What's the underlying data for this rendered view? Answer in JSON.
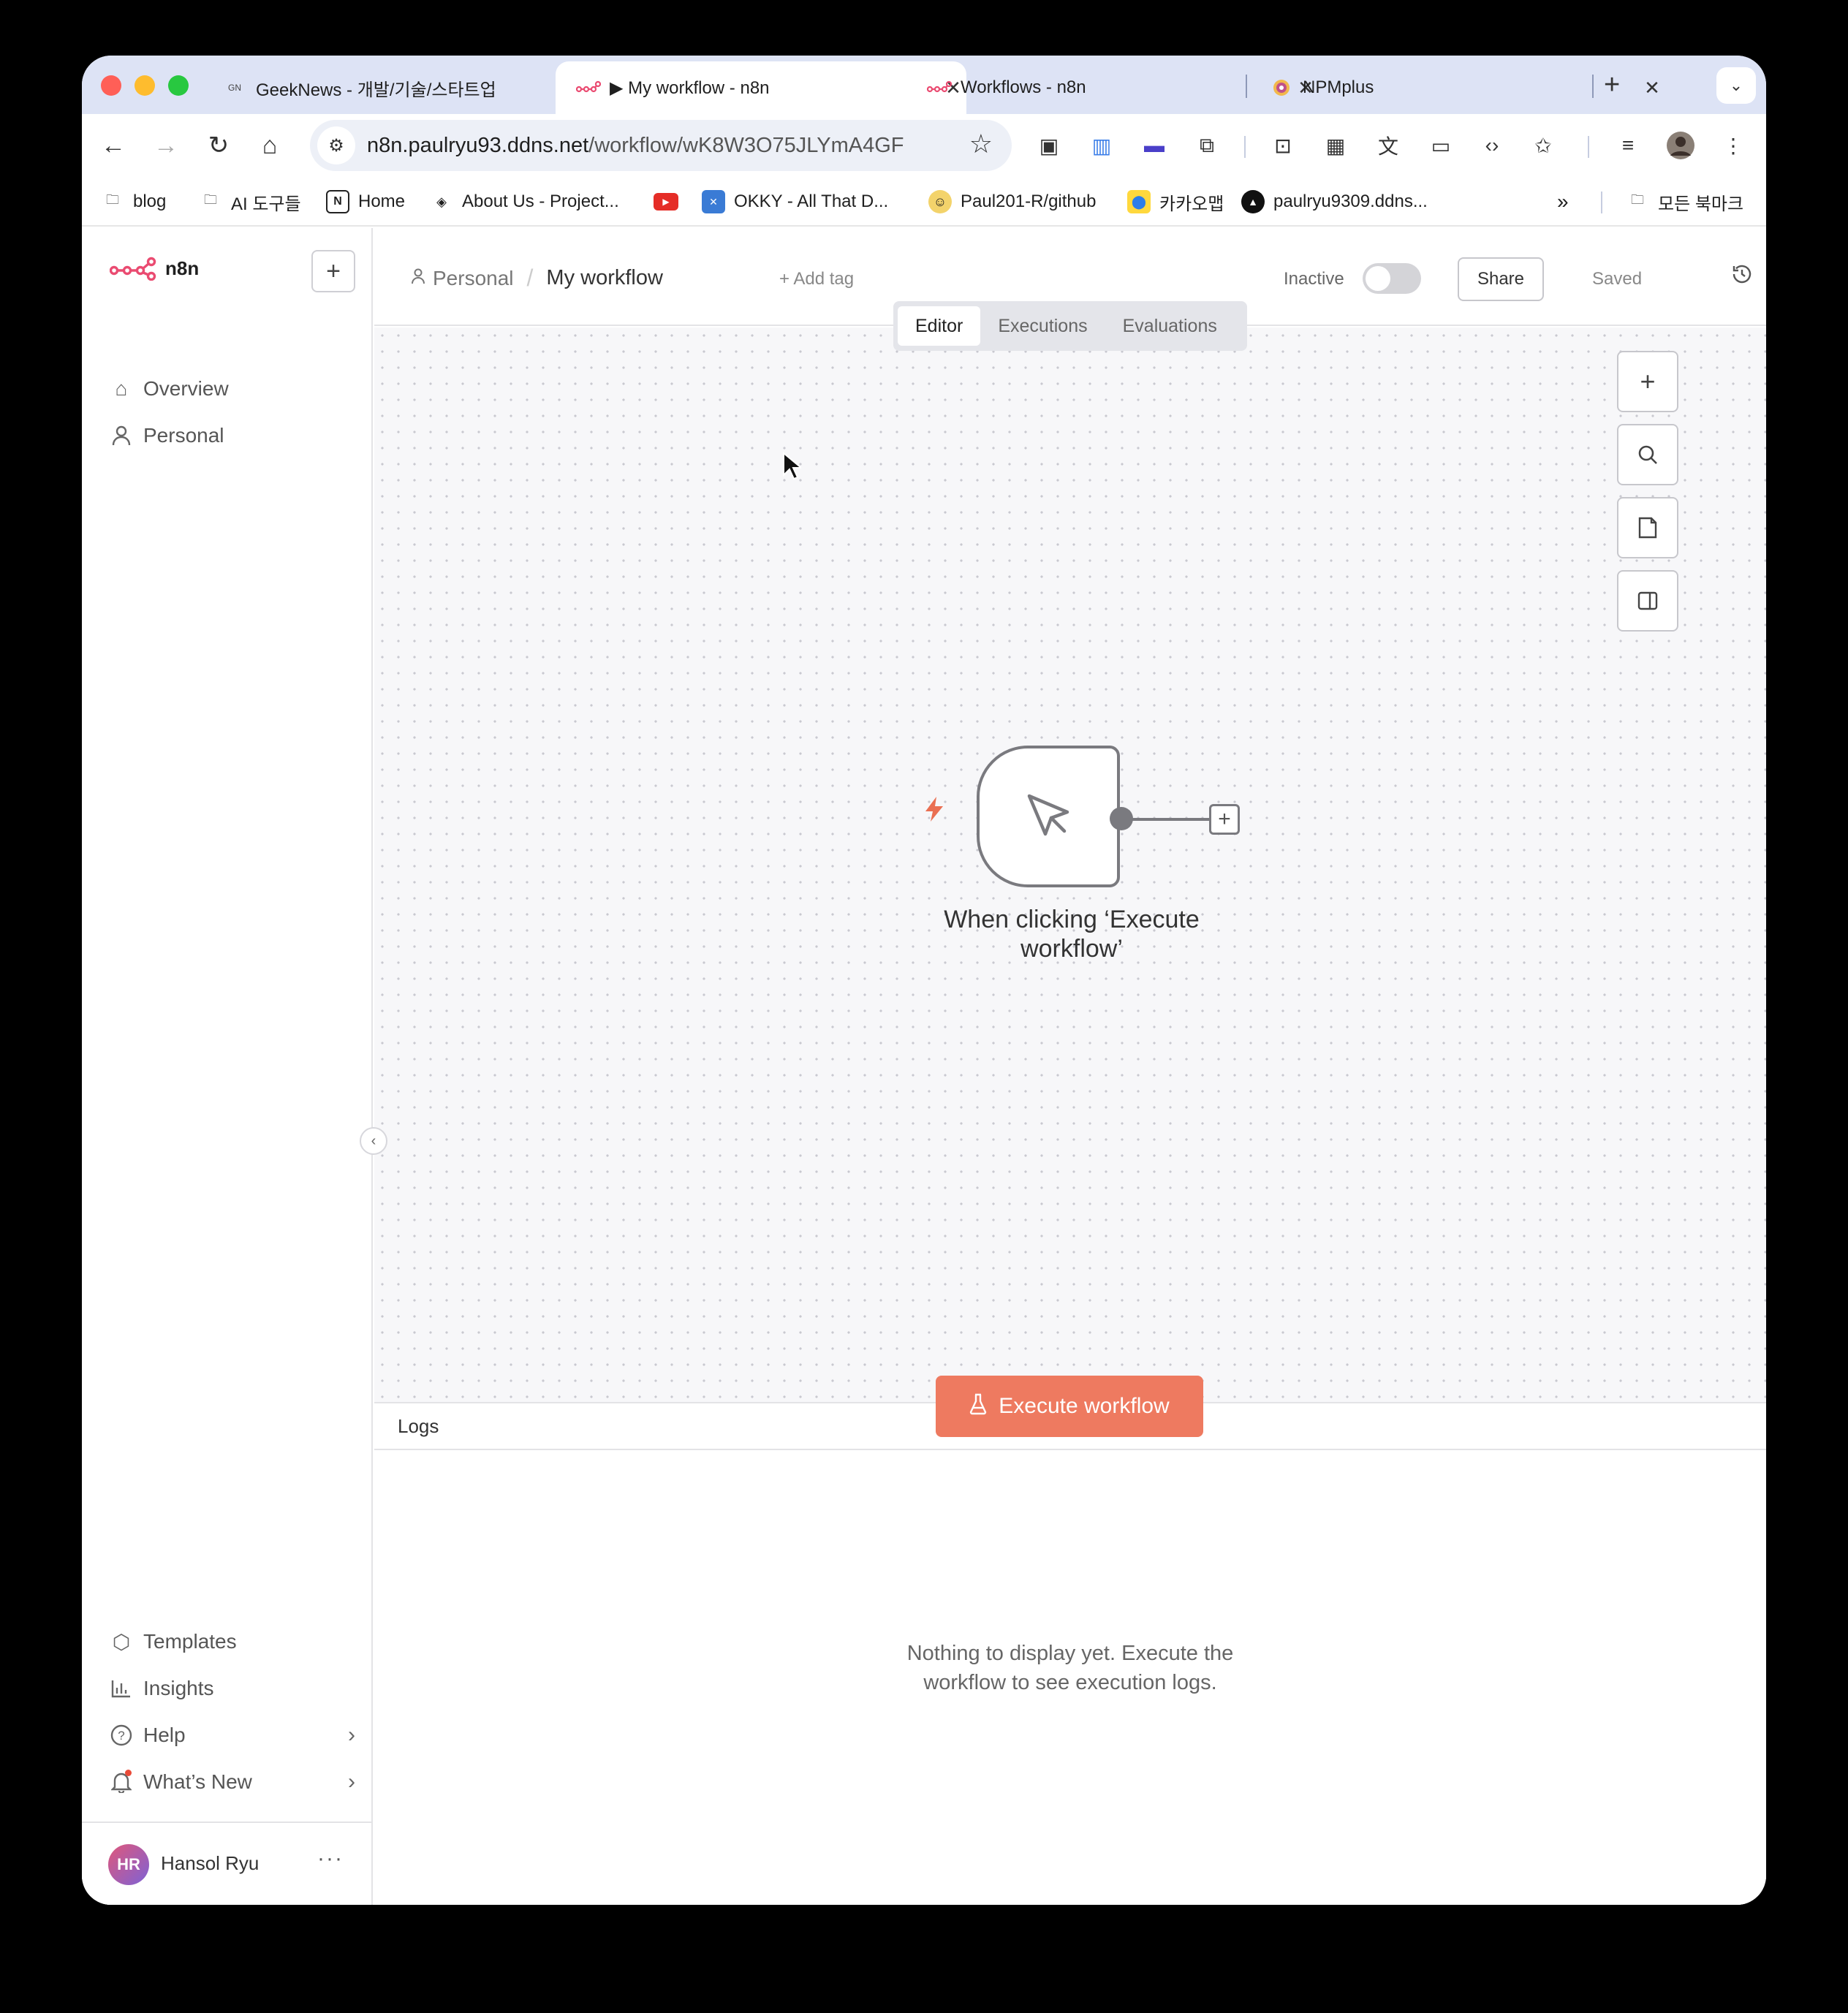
{
  "browser": {
    "tabs": [
      {
        "title": "GeekNews - 개발/기술/스타트업",
        "favicon": "GN",
        "active": false
      },
      {
        "title": "▶ My workflow - n8n",
        "favicon": "n8n",
        "active": true
      },
      {
        "title": "Workflows - n8n",
        "favicon": "n8n",
        "active": false
      },
      {
        "title": "NPMplus",
        "favicon": "npm",
        "active": false
      }
    ],
    "url_host": "n8n.paulryu93.ddns.net",
    "url_path": "/workflow/wK8W3O75JLYmA4GF",
    "bookmarks": [
      {
        "label": "blog",
        "icon": "folder-icon"
      },
      {
        "label": "AI 도구들",
        "icon": "folder-icon"
      },
      {
        "label": "Home",
        "icon": "notion-icon"
      },
      {
        "label": "About Us - Project...",
        "icon": "stack-icon"
      },
      {
        "label": "",
        "icon": "youtube-icon"
      },
      {
        "label": "OKKY - All That D...",
        "icon": "okky-icon"
      },
      {
        "label": "Paul201-R/github",
        "icon": "emoji-icon"
      },
      {
        "label": "카카오맵",
        "icon": "map-pin-icon"
      },
      {
        "label": "paulryu9309.ddns...",
        "icon": "triangle-icon"
      }
    ],
    "all_bookmarks": "모든 북마크"
  },
  "sidebar": {
    "logo": "n8n",
    "top_items": [
      {
        "label": "Overview",
        "icon": "home-icon"
      },
      {
        "label": "Personal",
        "icon": "user-icon"
      }
    ],
    "bottom_items": [
      {
        "label": "Templates",
        "icon": "box-icon"
      },
      {
        "label": "Insights",
        "icon": "chart-icon"
      },
      {
        "label": "Help",
        "icon": "help-icon"
      },
      {
        "label": "What’s New",
        "icon": "bell-icon"
      }
    ],
    "user": {
      "initials": "HR",
      "name": "Hansol Ryu"
    }
  },
  "header": {
    "project": "Personal",
    "workflow_name": "My workflow",
    "add_tag": "+ Add tag",
    "status": "Inactive",
    "share": "Share",
    "saved": "Saved"
  },
  "view_tabs": [
    "Editor",
    "Executions",
    "Evaluations"
  ],
  "canvas": {
    "node_label": "When clicking ‘Execute workflow’",
    "execute_button": "Execute workflow"
  },
  "logs": {
    "title": "Logs",
    "empty_message": "Nothing to display yet. Execute the workflow to see execution logs."
  },
  "colors": {
    "accent": "#ee7a60",
    "trigger": "#ea6f52",
    "brand": "#ea4b71"
  }
}
